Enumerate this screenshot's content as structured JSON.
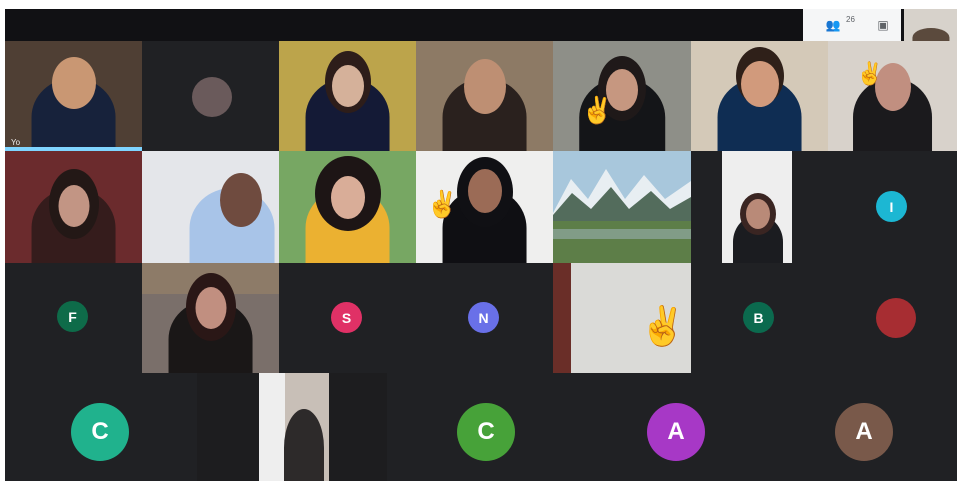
{
  "window": {
    "self_view": "self-view",
    "people_icon": "people-icon",
    "chat_icon": "chat-icon"
  },
  "participants": {
    "tiles": [
      {
        "name": "participant-1",
        "label": "Yo"
      },
      {
        "name": "participant-2"
      },
      {
        "name": "participant-3"
      },
      {
        "name": "participant-4"
      },
      {
        "name": "participant-5"
      },
      {
        "name": "participant-6"
      },
      {
        "name": "participant-7"
      },
      {
        "name": "participant-8"
      },
      {
        "name": "participant-9"
      },
      {
        "name": "participant-10"
      },
      {
        "name": "participant-11"
      },
      {
        "name": "participant-12"
      },
      {
        "name": "participant-13"
      },
      {
        "name": "participant-14"
      },
      {
        "name": "participant-15"
      },
      {
        "name": "participant-16"
      },
      {
        "name": "participant-17"
      },
      {
        "name": "participant-18"
      },
      {
        "name": "participant-19"
      }
    ],
    "avatars": [
      {
        "name": "avatar-i",
        "letter": "I",
        "color": "#1cb7d3"
      },
      {
        "name": "avatar-f",
        "letter": "F",
        "color": "#0e6b49"
      },
      {
        "name": "avatar-s",
        "letter": "S",
        "color": "#e03166"
      },
      {
        "name": "avatar-n",
        "letter": "N",
        "color": "#6970e8"
      },
      {
        "name": "avatar-b",
        "letter": "B",
        "color": "#0b6a4e"
      },
      {
        "name": "avatar-c1",
        "letter": "C",
        "color": "#20b28d"
      },
      {
        "name": "avatar-c2",
        "letter": "C",
        "color": "#47a239"
      },
      {
        "name": "avatar-a1",
        "letter": "A",
        "color": "#a738c6"
      },
      {
        "name": "avatar-a2",
        "letter": "A",
        "color": "#79594a"
      }
    ]
  }
}
